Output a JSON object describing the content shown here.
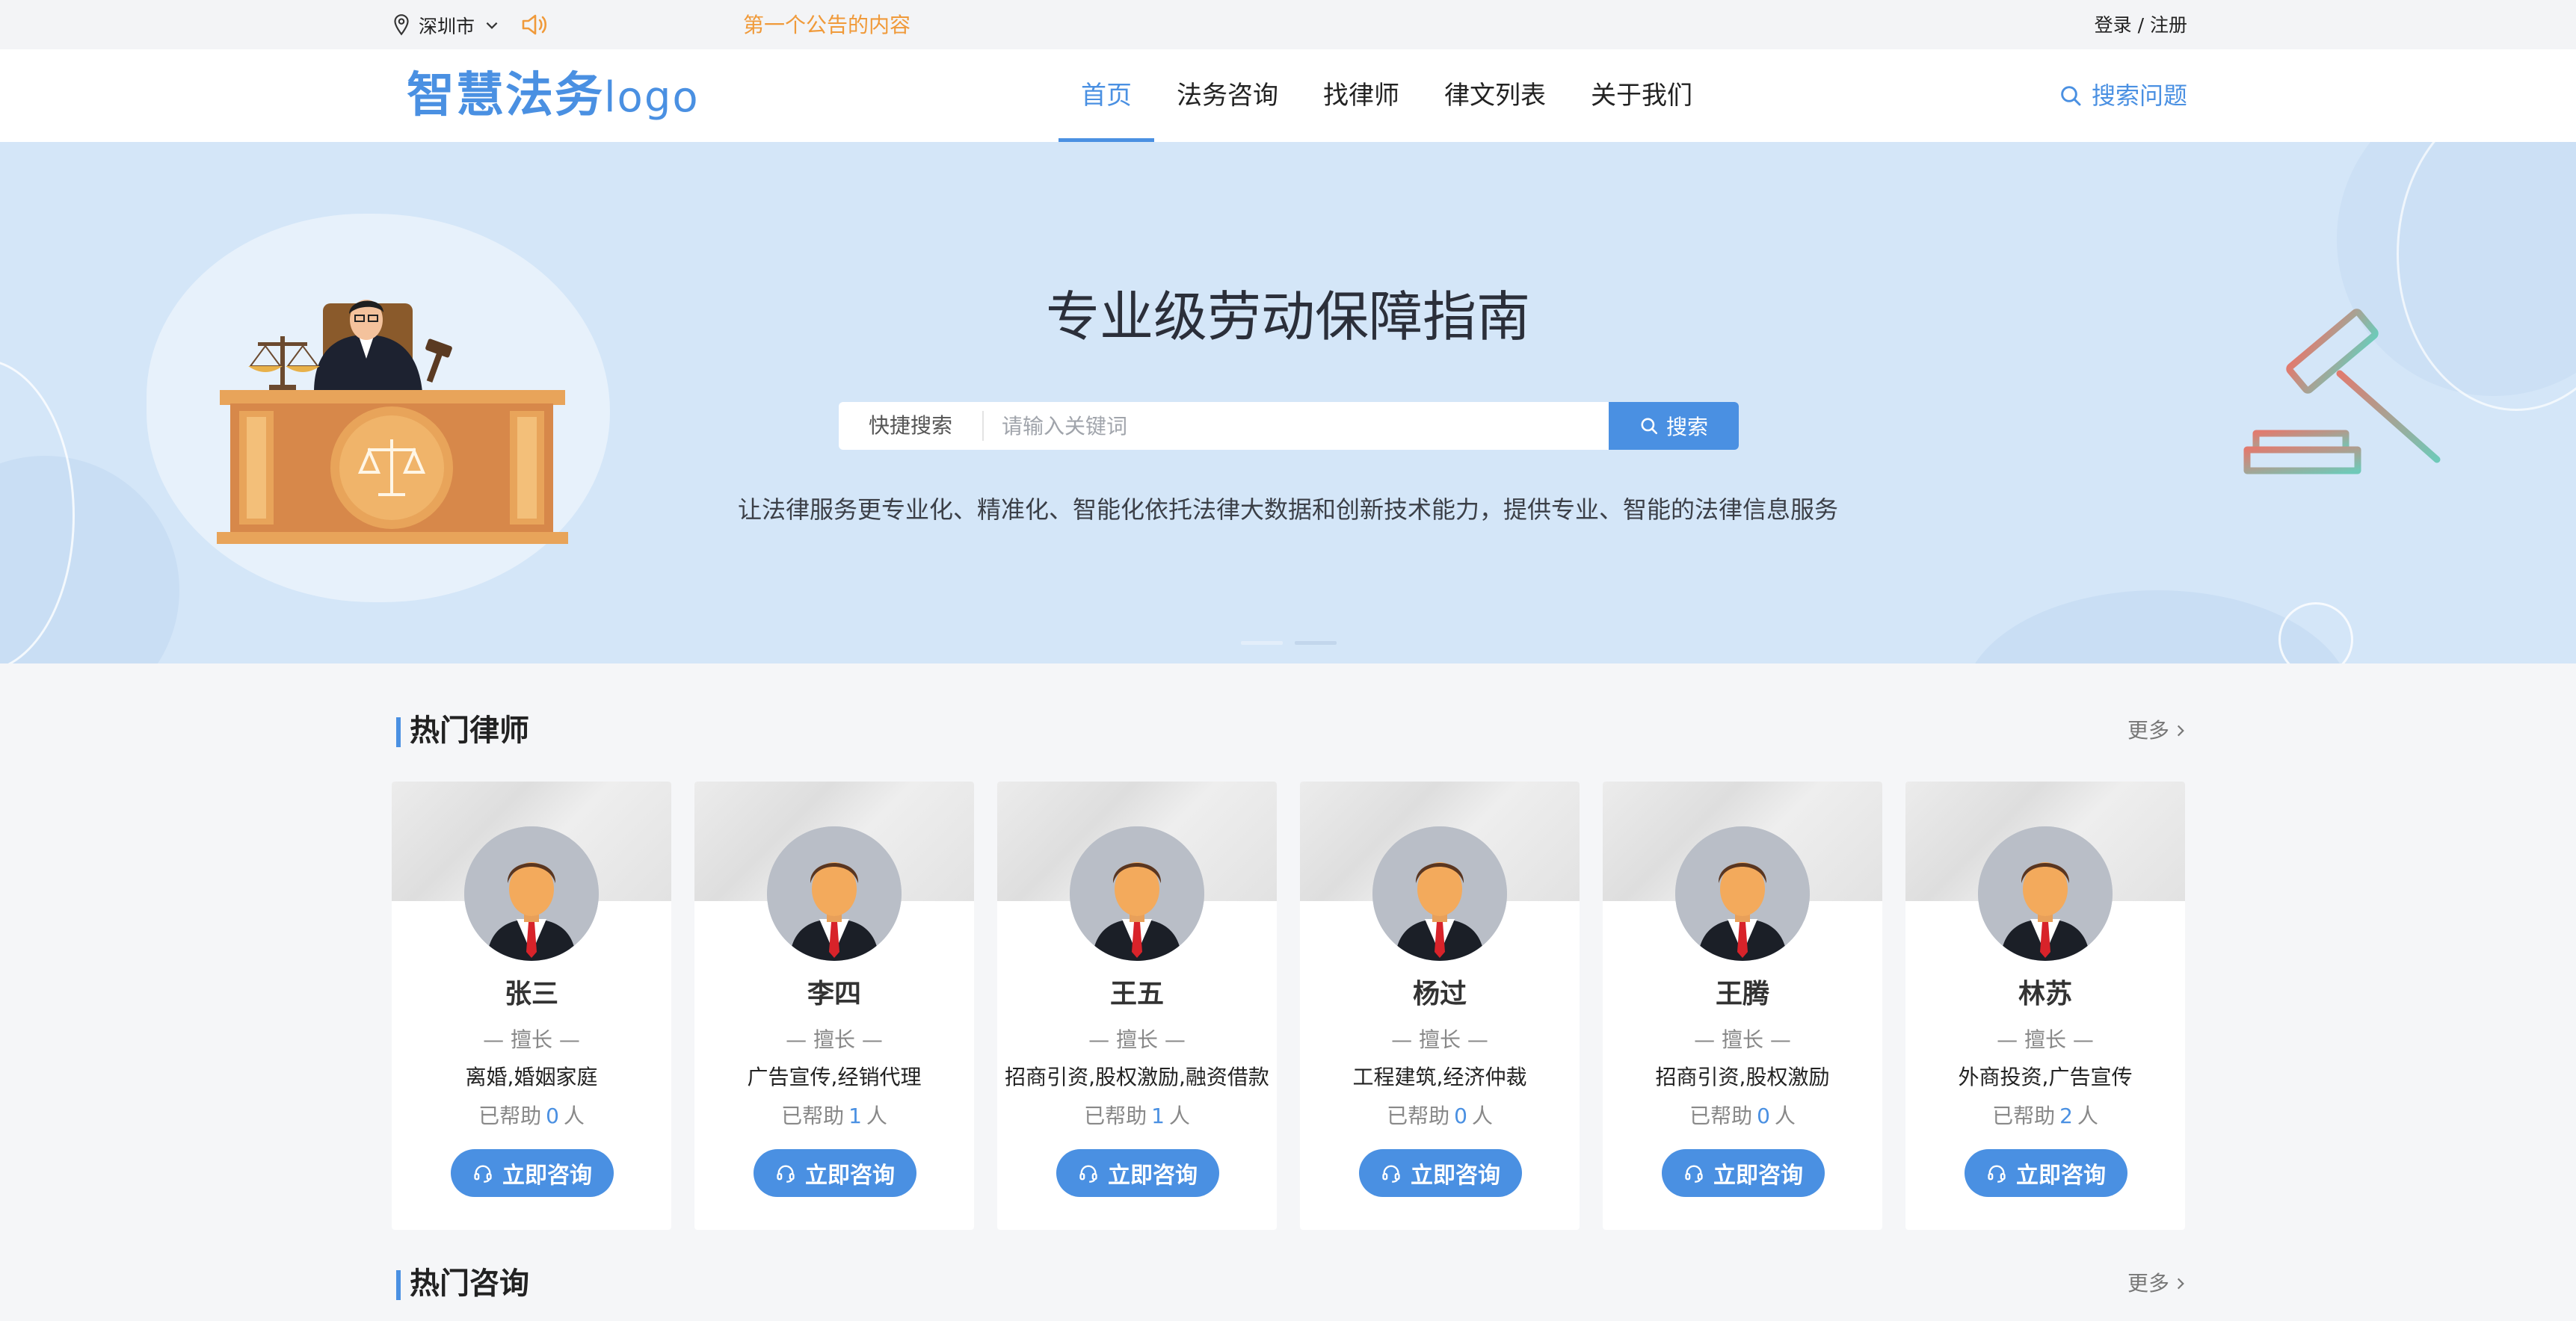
{
  "topbar": {
    "city": "深圳市",
    "notice": "第一个公告的内容",
    "login": "登录 / 注册"
  },
  "header": {
    "logo_main": "智慧法务",
    "logo_sub": "logo",
    "nav": [
      "首页",
      "法务咨询",
      "找律师",
      "律文列表",
      "关于我们"
    ],
    "search_link": "搜索问题"
  },
  "banner": {
    "title": "专业级劳动保障指南",
    "search_label": "快捷搜索",
    "search_placeholder": "请输入关键词",
    "search_button": "搜索",
    "slogan": "让法律服务更专业化、精准化、智能化依托法律大数据和创新技术能力，提供专业、智能的法律信息服务"
  },
  "lawyers_section": {
    "title": "热门律师",
    "more": "更多",
    "specialty_label": "— 擅长 —",
    "help_prefix": "已帮助",
    "help_suffix": "人",
    "button": "立即咨询",
    "items": [
      {
        "name": "张三",
        "fields": "离婚,婚姻家庭",
        "helped": "0"
      },
      {
        "name": "李四",
        "fields": "广告宣传,经销代理",
        "helped": "1"
      },
      {
        "name": "王五",
        "fields": "招商引资,股权激励,融资借款",
        "helped": "1"
      },
      {
        "name": "杨过",
        "fields": "工程建筑,经济仲裁",
        "helped": "0"
      },
      {
        "name": "王腾",
        "fields": "招商引资,股权激励",
        "helped": "0"
      },
      {
        "name": "林苏",
        "fields": "外商投资,广告宣传",
        "helped": "2"
      }
    ]
  },
  "consult_section": {
    "title": "热门咨询",
    "more": "更多"
  },
  "colors": {
    "accent": "#4a90e2",
    "notice": "#f09a3a",
    "banner_bg": "#d4e6f8"
  }
}
